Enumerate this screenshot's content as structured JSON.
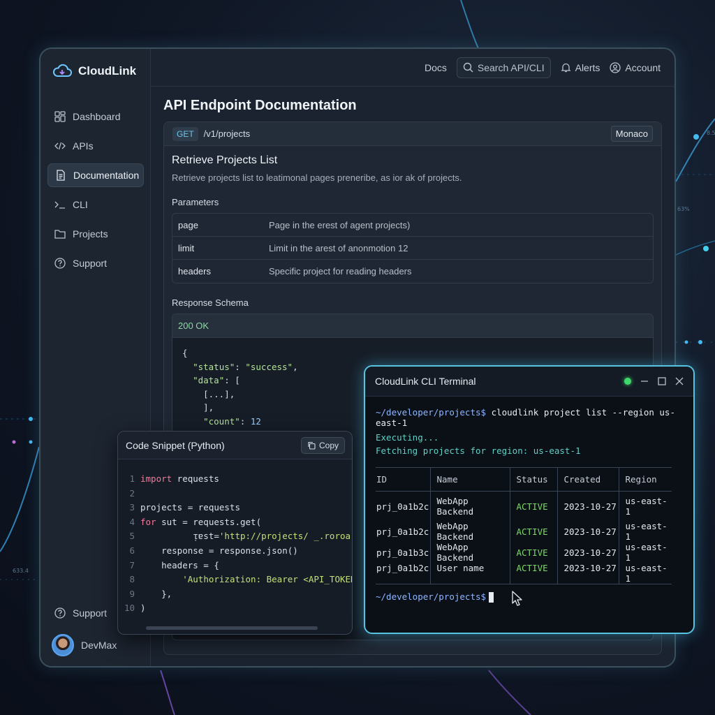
{
  "app": {
    "brand": "CloudLink"
  },
  "sidebar": {
    "items": [
      {
        "label": "Dashboard",
        "icon": "dashboard-icon"
      },
      {
        "label": "APIs",
        "icon": "code-icon"
      },
      {
        "label": "Documentation",
        "icon": "document-icon",
        "active": true
      },
      {
        "label": "CLI",
        "icon": "terminal-icon"
      },
      {
        "label": "Projects",
        "icon": "folder-icon"
      },
      {
        "label": "Support",
        "icon": "help-icon"
      }
    ],
    "bottom_support": "Support",
    "user_name": "DevMax"
  },
  "topbar": {
    "docs": "Docs",
    "search_placeholder": "Search API/CLI",
    "alerts": "Alerts",
    "account": "Account"
  },
  "doc": {
    "page_title": "API Endpoint Documentation",
    "method": "GET",
    "path": "/v1/projects",
    "editor": "Monaco",
    "section_title": "Retrieve Projects List",
    "section_desc": "Retrieve projects list to leatimonal pages preneribe, as ior ak of projects.",
    "params_label": "Parameters",
    "params": [
      {
        "name": "page",
        "desc": "Page in the erest of agent projects)"
      },
      {
        "name": "limit",
        "desc": "Limit in the arest of anonmotion 12"
      },
      {
        "name": "headers",
        "desc": "Specific project for reading headers"
      }
    ],
    "response_label": "Response Schema",
    "response_status": "200 OK",
    "json_lines": {
      "l1": "{",
      "l2_key": "\"status\"",
      "l2_val": "\"success\"",
      "l3_key": "\"data\"",
      "l3_rest": ": [",
      "l4": "[...],",
      "l5": "],",
      "l6_key": "\"count\"",
      "l6_val": "12"
    }
  },
  "snippet": {
    "title": "Code Snippet (Python)",
    "copy_label": "Copy",
    "lines": [
      {
        "n": "1",
        "kw": "import",
        "rest": " requests"
      },
      {
        "n": "2",
        "kw": "",
        "rest": ""
      },
      {
        "n": "3",
        "kw": "",
        "rest": "projects = requests"
      },
      {
        "n": "4",
        "kw": "for",
        "rest": " sut = requests.get("
      },
      {
        "n": "5",
        "kw": "",
        "rest": "          ᴉɐst=",
        "str": "'http://projects/ _.roroart"
      },
      {
        "n": "6",
        "kw": "",
        "rest": "    response = response.json()"
      },
      {
        "n": "7",
        "kw": "",
        "rest": "    headers = {"
      },
      {
        "n": "8",
        "kw": "",
        "rest": "        ",
        "str": "'Authorization: Bearer <API_TOKEN>',"
      },
      {
        "n": "9",
        "kw": "",
        "rest": "    },"
      },
      {
        "n": "10",
        "kw": "",
        "rest": ")"
      }
    ]
  },
  "terminal": {
    "title": "CloudLink CLI Terminal",
    "prompt": "~/developer/projects$",
    "command": "cloudlink project list --region us-east-1",
    "executing": "Executing...",
    "fetching": "Fetching projects for region: us-east-1",
    "columns": [
      "ID",
      "Name",
      "Status",
      "Created",
      "Region"
    ],
    "rows": [
      [
        "prj_0a1b2c",
        "WebApp Backend",
        "ACTIVE",
        "2023-10-27",
        "us-east-1"
      ],
      [
        "prj_0a1b2c",
        "WebApp Backend",
        "ACTIVE",
        "2023-10-27",
        "us-east-1"
      ],
      [
        "prj_0a1b3c",
        "WebApp Backend",
        "ACTIVE",
        "2023-10-27",
        "us-east-1"
      ],
      [
        "prj_0a1b2c",
        "User name",
        "ACTIVE",
        "2023-10-27",
        "us-east-1"
      ]
    ],
    "final_prompt": "~/developer/projects$"
  },
  "background": {
    "labels": [
      "8.5",
      "63%",
      "633.4"
    ]
  },
  "colors": {
    "accent": "#57c4e2",
    "active_status": "#7fd86a",
    "background": "#0f1624"
  }
}
